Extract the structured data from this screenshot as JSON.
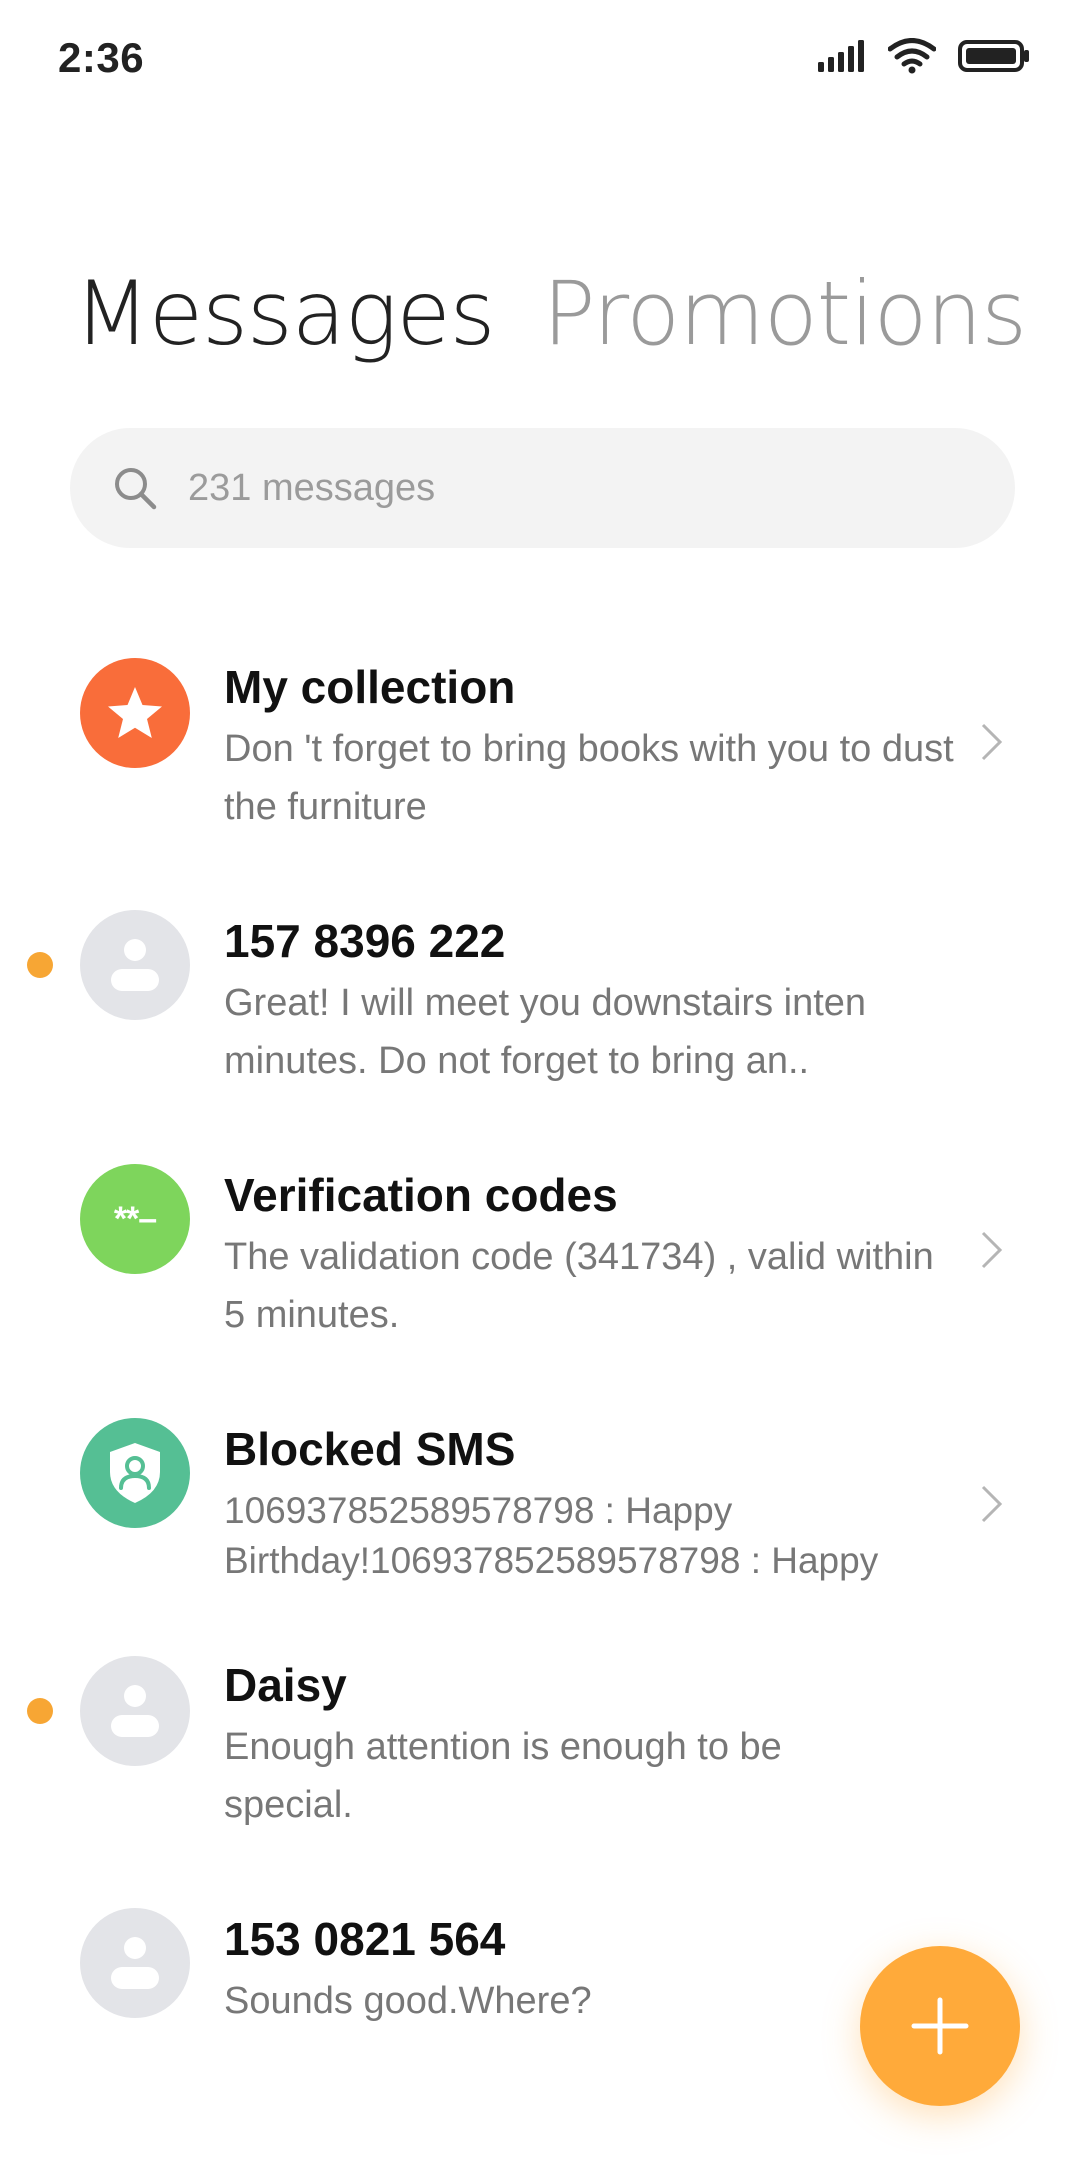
{
  "status_bar": {
    "time": "2:36",
    "icons": [
      "signal-icon",
      "wifi-icon",
      "battery-icon"
    ]
  },
  "tabs": [
    {
      "label": "Messages",
      "active": true
    },
    {
      "label": "Promotions",
      "active": false
    }
  ],
  "search": {
    "placeholder": "231 messages",
    "icon": "search-icon"
  },
  "conversations": [
    {
      "title": "My collection",
      "preview": "Don 't forget to bring books with you to dust the furniture",
      "avatar": "star-icon",
      "avatar_color": "#f96d3a",
      "unread": false,
      "chevron": true
    },
    {
      "title": "157 8396 222",
      "preview": "Great! I will meet you downstairs inten minutes. Do not forget to bring an..",
      "avatar": "person-icon",
      "avatar_color": "#e3e4e8",
      "unread": true,
      "chevron": false
    },
    {
      "title": "Verification codes",
      "preview": "The validation code (341734) , valid within 5 minutes.",
      "avatar": "code-icon",
      "avatar_text": "**–",
      "avatar_color": "#7ed55c",
      "unread": false,
      "chevron": true
    },
    {
      "title": "Blocked SMS",
      "preview_lines": [
        "106937852589578798 : Happy",
        "Birthday!106937852589578798 : Happy"
      ],
      "avatar": "shield-person-icon",
      "avatar_color": "#55bf94",
      "unread": false,
      "chevron": true
    },
    {
      "title": "Daisy",
      "preview": "Enough attention is enough to be special.",
      "avatar": "person-icon",
      "avatar_color": "#e3e4e8",
      "unread": true,
      "chevron": false
    },
    {
      "title": "153 0821 564",
      "preview": "Sounds good.Where?",
      "avatar": "person-icon",
      "avatar_color": "#e3e4e8",
      "unread": false,
      "chevron": false
    }
  ],
  "fab": {
    "icon": "plus-icon",
    "color": "#ffaa3a"
  },
  "colors": {
    "unread_dot": "#f7a634",
    "accent": "#ffaa3a"
  }
}
